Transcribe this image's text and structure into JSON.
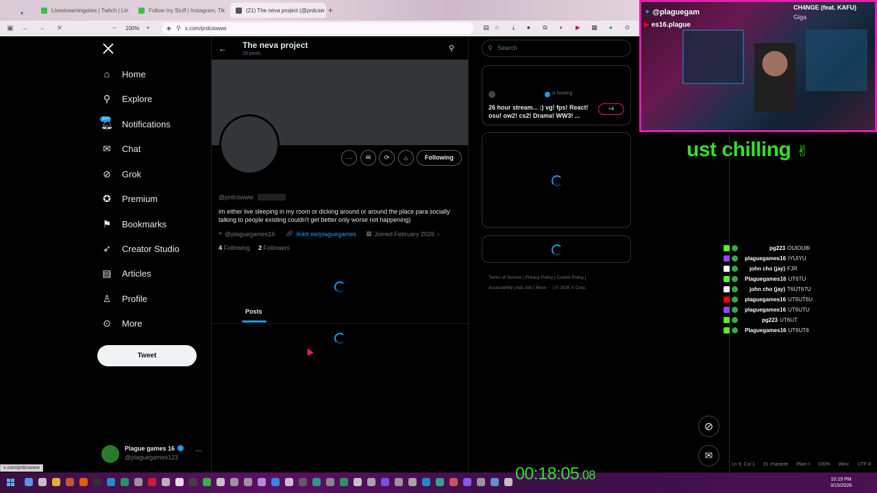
{
  "browser": {
    "tabs": [
      {
        "title": "Livestreamingsites | Twitch | Lin",
        "color": "#33c24a"
      },
      {
        "title": "Follow my Stuff | Instagram, Tik",
        "color": "#33c24a"
      },
      {
        "title": "(21) The neva project (@prdcsw",
        "color": "#555555"
      }
    ],
    "zoom": "100%",
    "url": "x.com/prdcswww",
    "status_url": "x.com/prdcswww"
  },
  "nav": {
    "items": [
      {
        "label": "Home",
        "icon": "home-icon"
      },
      {
        "label": "Explore",
        "icon": "search-icon"
      },
      {
        "label": "Notifications",
        "icon": "bell-icon",
        "badge": "20+"
      },
      {
        "label": "Chat",
        "icon": "mail-icon"
      },
      {
        "label": "Grok",
        "icon": "grok-icon"
      },
      {
        "label": "Premium",
        "icon": "verified-icon"
      },
      {
        "label": "Bookmarks",
        "icon": "bookmark-icon"
      },
      {
        "label": "Creator Studio",
        "icon": "rocket-icon"
      },
      {
        "label": "Articles",
        "icon": "article-icon"
      },
      {
        "label": "Profile",
        "icon": "person-icon"
      },
      {
        "label": "More",
        "icon": "more-icon"
      }
    ],
    "tweet_label": "Tweet",
    "account": {
      "name": "Plague games 16",
      "handle": "@plaguegames123"
    }
  },
  "profile": {
    "header_name": "The neva project",
    "post_count": "20 posts",
    "handle": "@prdcswww",
    "bio": "im either live sleeping in my room or dicking around or around the place para socially talking to people existing couldn't get better only worse not happening)",
    "location": "@plaguegames16",
    "link": "linktr.ee/plaguegames",
    "joined": "Joined February 2026",
    "following_count": "4",
    "following_label": "Following",
    "followers_count": "2",
    "followers_label": "Followers",
    "follow_button": "Following",
    "tab_posts": "Posts"
  },
  "sidebar": {
    "search_placeholder": "Search",
    "live": {
      "status": "is hosting",
      "title": "26 hour stream... :) vg! fps! React! osu! ow2! cs2! Drama! WW3! ...",
      "plus": "+4"
    },
    "footer": [
      "Terms of Service",
      "Privacy Policy",
      "Cookie Policy",
      "Accessibility",
      "Ads info",
      "More ···",
      "© 2026 X Corp."
    ]
  },
  "stream": {
    "cam_handle": "@plaguegam",
    "cam_handle2": "es16.plague",
    "song_title": "CH4NGE (feat. KAFU)",
    "song_artist": "Giga",
    "banner": "ust chilling",
    "timer": "00:18:05",
    "timer_ms": ".08",
    "chat": [
      {
        "src": "#53fc18",
        "user": "pg223",
        "msg": "OUIOU8I",
        "ucolor": "#ffffff"
      },
      {
        "src": "#9146ff",
        "user": "plaguegames16",
        "msg": "IYUIYU",
        "ucolor": "#ffffff"
      },
      {
        "src": "#ffffff",
        "user": "john cho (jay)",
        "msg": "FJR",
        "ucolor": "#ffffff"
      },
      {
        "src": "#53fc18",
        "user": "Plaguegames16",
        "msg": "UT6TU",
        "ucolor": "#ffffff"
      },
      {
        "src": "#ffffff",
        "user": "john cho (jay)",
        "msg": "T6UT67U",
        "ucolor": "#ffffff"
      },
      {
        "src": "#ff0000",
        "user": "plaguegames16",
        "msg": "UT6UT6U",
        "ucolor": "#ffffff"
      },
      {
        "src": "#9146ff",
        "user": "plaguegames16",
        "msg": "UT6UTU",
        "ucolor": "#ffffff"
      },
      {
        "src": "#53fc18",
        "user": "pg223",
        "msg": "UT6UT",
        "ucolor": "#ffffff"
      },
      {
        "src": "#53fc18",
        "user": "Plaguegames16",
        "msg": "UT6UT6",
        "ucolor": "#ffffff"
      }
    ]
  },
  "editor_status": {
    "pos": "Ln 9, Col 1",
    "chars": "31 characte",
    "mode": "Plain t",
    "zoom": "100%",
    "eol": "Winc",
    "enc": "UTF-8"
  },
  "clock": {
    "time": "10:19 PM",
    "date": "3/15/2026"
  },
  "colors": {
    "accent": "#1d9bf0",
    "stream_border": "#e020b0",
    "timer": "#33e02a"
  }
}
